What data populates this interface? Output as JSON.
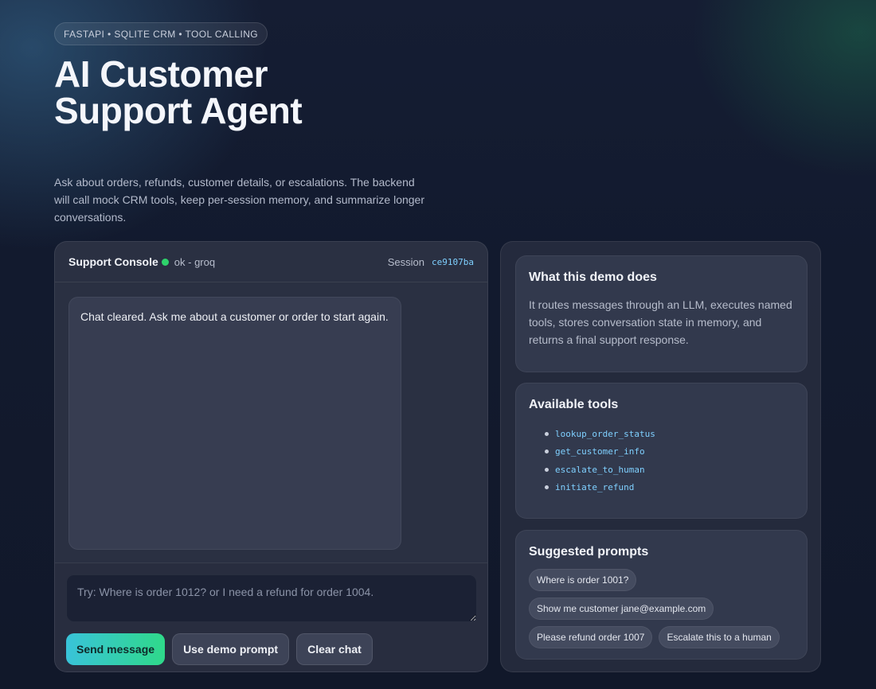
{
  "hero": {
    "badge": "FASTAPI • SQLITE CRM • TOOL CALLING",
    "title": "AI Customer Support Agent",
    "subtitle": "Ask about orders, refunds, customer details, or escalations. The backend will call mock CRM tools, keep per-session memory, and summarize longer conversations."
  },
  "console": {
    "title": "Support Console",
    "status": "ok - groq",
    "status_color": "#2ed36b",
    "session_label": "Session",
    "session_id": "ce9107ba",
    "messages": [
      {
        "role": "assistant",
        "text": "Chat cleared. Ask me about a customer or order to start again."
      }
    ],
    "input_placeholder": "Try: Where is order 1012? or I need a refund for order 1004.",
    "send_label": "Send message",
    "demo_label": "Use demo prompt",
    "clear_label": "Clear chat"
  },
  "sidebar": {
    "about": {
      "title": "What this demo does",
      "text": "It routes messages through an LLM, executes named tools, stores conversation state in memory, and returns a final support response."
    },
    "tools": {
      "title": "Available tools",
      "items": [
        "lookup_order_status",
        "get_customer_info",
        "escalate_to_human",
        "initiate_refund"
      ]
    },
    "prompts": {
      "title": "Suggested prompts",
      "items": [
        "Where is order 1001?",
        "Show me customer jane@example.com",
        "Please refund order 1007",
        "Escalate this to a human"
      ]
    }
  },
  "colors": {
    "accent_gradient_start": "#39c3d9",
    "accent_gradient_end": "#2fd98a",
    "code_text": "#7fd0ff"
  }
}
